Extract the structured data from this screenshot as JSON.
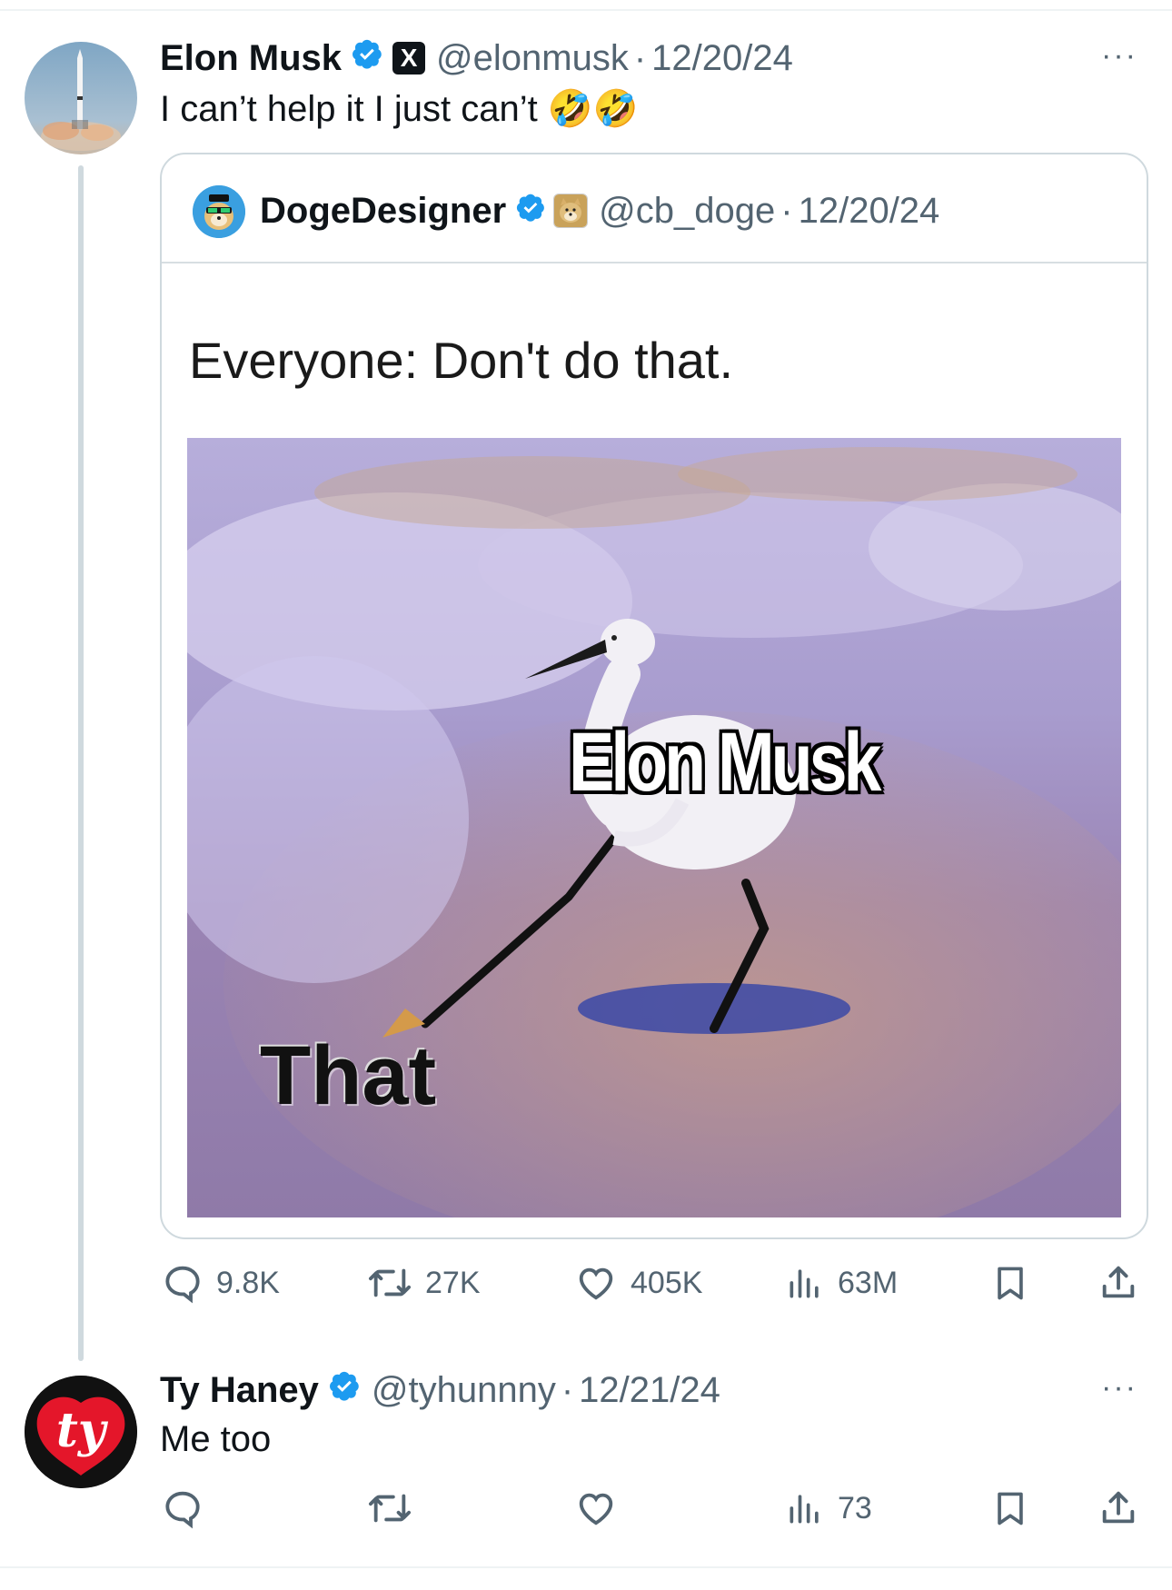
{
  "colors": {
    "verified": "#1d9bf0",
    "muted": "#536471",
    "text": "#0f1419",
    "border": "#cfd9de"
  },
  "main_post": {
    "author_name": "Elon Musk",
    "handle": "@elonmusk",
    "separator": "·",
    "date": "12/20/24",
    "text": "I can’t help it I just can’t 🤣🤣",
    "affiliate_badge": "X",
    "more_label": "···",
    "quoted_post": {
      "author_name": "DogeDesigner",
      "handle": "@cb_doge",
      "separator": "·",
      "date": "12/20/24",
      "meme_caption": "Everyone: Don't do that.",
      "meme_labels": {
        "bird": "Elon Musk",
        "line": "That"
      }
    },
    "actions": {
      "replies": "9.8K",
      "reposts": "27K",
      "likes": "405K",
      "views": "63M"
    }
  },
  "reply_post": {
    "author_name": "Ty Haney",
    "handle": "@tyhunnny",
    "separator": "·",
    "date": "12/21/24",
    "text": "Me too",
    "more_label": "···",
    "avatar_logo": "ty",
    "actions": {
      "views": "73"
    }
  },
  "icons": {
    "reply": "speech-bubble-icon",
    "repost": "repost-arrows-icon",
    "like": "heart-icon",
    "views": "bar-chart-icon",
    "bookmark": "bookmark-icon",
    "share": "share-upload-icon",
    "verified": "verified-badge-icon"
  }
}
